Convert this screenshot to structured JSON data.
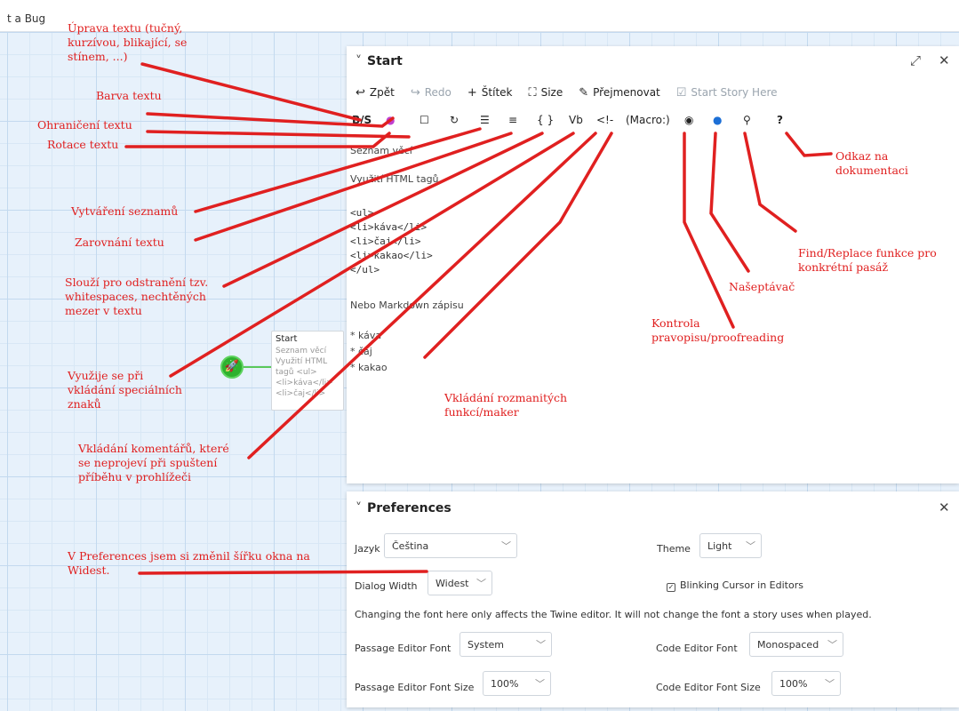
{
  "topbar": {
    "report_text": "t a Bug"
  },
  "passage_card": {
    "title": "Start",
    "excerpt": "Seznam věcí\nVyužití HTML\ntagů <ul>\n<li>káva</li>\n<li>čaj</li>",
    "marker_icon": "rocket-icon"
  },
  "start_dialog": {
    "title": "Start",
    "chevron": "˅",
    "maximize_icon": "⤢",
    "close_icon": "✕",
    "toolbar1": {
      "undo": {
        "icon": "↩",
        "label": "Zpět"
      },
      "redo": {
        "icon": "↪",
        "label": "Redo"
      },
      "tag": {
        "icon": "+",
        "label": "Štítek"
      },
      "size": {
        "icon": "⛶",
        "label": "Size"
      },
      "rename": {
        "icon": "✎",
        "label": "Přejmenovat"
      },
      "start_here": {
        "icon": "☑",
        "label": "Start Story Here"
      }
    },
    "toolbar2": {
      "format": "B/S",
      "color": "●",
      "border": "☐",
      "rotate": "↻",
      "list": "☰",
      "align": "≡",
      "collapse": "{ }",
      "verbatim": "Vb",
      "comment": "<!-",
      "macro": "(Macro:)",
      "proof": "◉",
      "hint": "●",
      "find": "⚲",
      "help": "?"
    },
    "editor_lines": [
      "Seznam věcí",
      "Využití HTML tagů",
      "<ul>",
      "<li>káva</li>",
      "<li>čaj</li>",
      "<li>kakao</li>",
      "</ul>",
      "Nebo Markdown zápisu",
      "* káva",
      "* čaj",
      "* kakao"
    ]
  },
  "prefs_dialog": {
    "title": "Preferences",
    "chevron": "˅",
    "close_icon": "✕",
    "language_label": "Jazyk",
    "language_value": "Čeština",
    "theme_label": "Theme",
    "theme_value": "Light",
    "dialog_width_label": "Dialog Width",
    "dialog_width_value": "Widest",
    "blinking_cursor_label": "Blinking Cursor in Editors",
    "blinking_cursor_checked": "✓",
    "font_note": "Changing the font here only affects the Twine editor. It will not change the font a story uses when played.",
    "passage_font_label": "Passage Editor Font",
    "passage_font_value": "System",
    "code_font_label": "Code Editor Font",
    "code_font_value": "Monospaced",
    "passage_font_size_label": "Passage Editor Font Size",
    "passage_font_size_value": "100%",
    "code_font_size_label": "Code Editor Font Size",
    "code_font_size_value": "100%",
    "arrow": "﹀"
  },
  "annotations": {
    "format": [
      "Úprava textu (tučný,",
      "kurzívou, blikající, se",
      "stínem, ...)"
    ],
    "color": "Barva textu",
    "border": "Ohraničení textu",
    "rotate": "Rotace textu",
    "list": "Vytváření seznamů",
    "align": "Zarovnání textu",
    "whitespace": [
      "Slouží pro odstranění tzv.",
      "whitespaces, nechtěných",
      "mezer v textu"
    ],
    "verbatim": [
      "Využije se při",
      "vkládání speciálních",
      "znaků"
    ],
    "comment": [
      "Vkládání komentářů, které",
      "se neprojeví při spuštení",
      "příběhu v prohlížeči"
    ],
    "macro": [
      "Vkládání rozmanitých",
      "funkcí/maker"
    ],
    "proof": [
      "Kontrola",
      "pravopisu/proofreading"
    ],
    "hint": "Našeptávač",
    "find": [
      "Find/Replace funkce pro",
      "konkrétní pasáž"
    ],
    "help": [
      "Odkaz na",
      "dokumentaci"
    ],
    "prefs": [
      "V Preferences jsem si změnil šířku okna na",
      "Widest."
    ]
  },
  "colors": {
    "annotation": "#e02020",
    "canvas": "#e7f1fb",
    "marker": "#2eb12e"
  }
}
